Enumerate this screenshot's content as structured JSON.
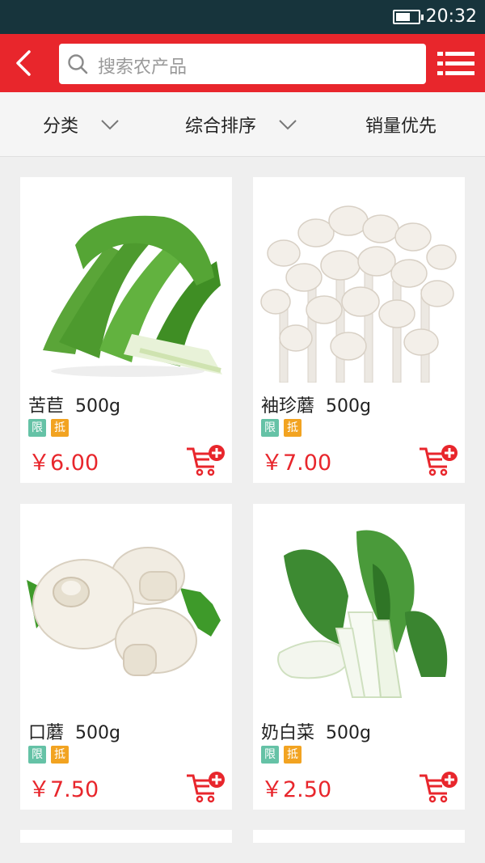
{
  "status_bar": {
    "time": "20:32",
    "battery_level": 0.65
  },
  "header": {
    "back_icon": "chevron-left-icon",
    "search_placeholder": "搜索农产品",
    "search_icon": "search-icon",
    "menu_icon": "menu-icon"
  },
  "filters": [
    {
      "label": "分类",
      "icon": "chevron-down-icon"
    },
    {
      "label": "综合排序",
      "icon": "chevron-down-icon"
    },
    {
      "label": "销量优先"
    }
  ],
  "products": [
    {
      "name": "苦苣",
      "spec": "500g",
      "tags": [
        "限",
        "抵"
      ],
      "price": "￥6.00",
      "image": "endive"
    },
    {
      "name": "袖珍蘑",
      "spec": "500g",
      "tags": [
        "限",
        "抵"
      ],
      "price": "￥7.00",
      "image": "white-beech-mushroom"
    },
    {
      "name": "口蘑",
      "spec": "500g",
      "tags": [
        "限",
        "抵"
      ],
      "price": "￥7.50",
      "image": "button-mushroom"
    },
    {
      "name": "奶白菜",
      "spec": "500g",
      "tags": [
        "限",
        "抵"
      ],
      "price": "￥2.50",
      "image": "bok-choy"
    }
  ],
  "colors": {
    "primary": "#e8262c",
    "status_bar": "#17343c",
    "tag_limit": "#65c2a6",
    "tag_deduct": "#f2a321"
  }
}
